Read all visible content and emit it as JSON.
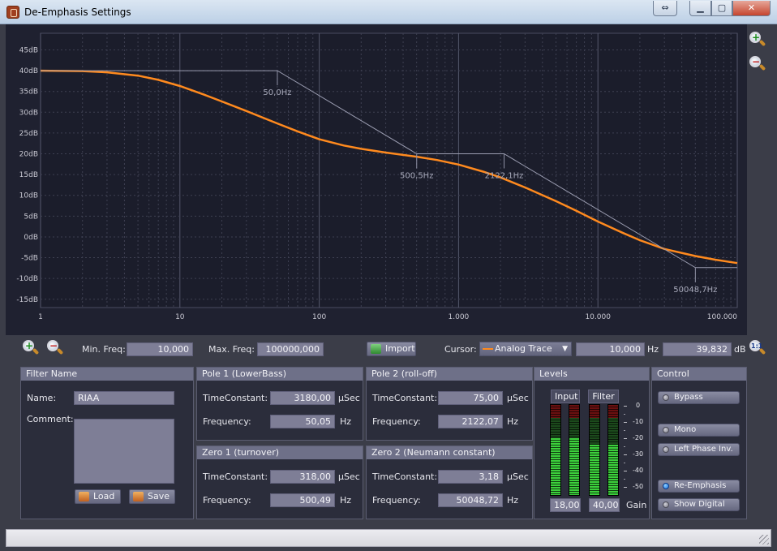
{
  "window": {
    "title": "De-Emphasis Settings"
  },
  "chart_data": {
    "type": "line",
    "x_scale": "log",
    "xlim": [
      1,
      100000
    ],
    "ylim": [
      -17,
      49
    ],
    "x_tick_labels": [
      {
        "x": 1,
        "label": "1"
      },
      {
        "x": 10,
        "label": "10"
      },
      {
        "x": 100,
        "label": "100"
      },
      {
        "x": 1000,
        "label": "1.000"
      },
      {
        "x": 10000,
        "label": "10.000"
      },
      {
        "x": 100000,
        "label": "100.000"
      }
    ],
    "y_ticks": [
      45,
      40,
      35,
      30,
      25,
      20,
      15,
      10,
      5,
      0,
      -5,
      -10,
      -15
    ],
    "y_tick_labels": [
      "45dB",
      "40dB",
      "35dB",
      "30dB",
      "25dB",
      "20dB",
      "15dB",
      "10dB",
      "5dB",
      "0dB",
      "-5dB",
      "-10dB",
      "-15dB"
    ],
    "grid": true,
    "series": [
      {
        "color": "#ff8a1e",
        "x": [
          1,
          2,
          3,
          5,
          7,
          10,
          15,
          20,
          30,
          50,
          70,
          100,
          150,
          200,
          300,
          500,
          700,
          1000,
          1500,
          2000,
          3000,
          5000,
          7000,
          10000,
          15000,
          20000,
          30000,
          50000,
          70000,
          100000
        ],
        "y": [
          40,
          39.9,
          39.6,
          38.8,
          37.8,
          36.3,
          34.2,
          32.6,
          30.3,
          27.3,
          25.4,
          23.5,
          22.0,
          21.2,
          20.3,
          19.3,
          18.5,
          17.4,
          15.7,
          14.3,
          11.9,
          8.6,
          6.3,
          3.7,
          1.0,
          -0.8,
          -2.9,
          -4.6,
          -5.5,
          -6.3
        ]
      },
      {
        "color": "#9a9cb0",
        "x": [
          1,
          50.05,
          500.49,
          2122.07,
          50048.72,
          100000
        ],
        "y": [
          40,
          40,
          20,
          20,
          -7.4,
          -7.4
        ]
      }
    ],
    "annotations": [
      {
        "x": 50.05,
        "y": 40,
        "label": "50,0Hz"
      },
      {
        "x": 500.49,
        "y": 20,
        "label": "500,5Hz"
      },
      {
        "x": 2122.07,
        "y": 20,
        "label": "2122,1Hz"
      },
      {
        "x": 50048.72,
        "y": -7.4,
        "label": "50048,7Hz"
      }
    ]
  },
  "toolbar": {
    "min_freq_label": "Min. Freq:",
    "min_freq": "10,000",
    "max_freq_label": "Max. Freq:",
    "max_freq": "100000,000",
    "import_label": "Import",
    "cursor_label": "Cursor:",
    "cursor_trace": "Analog Trace",
    "cursor_freq": "10,000",
    "hz_unit": "Hz",
    "cursor_db": "39,832",
    "db_unit": "dB"
  },
  "filter": {
    "head": "Filter Name",
    "name_label": "Name:",
    "name": "RIAA",
    "comment_label": "Comment:",
    "load_label": "Load",
    "save_label": "Save"
  },
  "pole1": {
    "head": "Pole 1 (LowerBass)",
    "tc_label": "TimeConstant:",
    "tc": "3180,00",
    "tc_unit": "µSec",
    "freq_label": "Frequency:",
    "freq": "50,05",
    "freq_unit": "Hz"
  },
  "pole2": {
    "head": "Pole 2 (roll-off)",
    "tc_label": "TimeConstant:",
    "tc": "75,00",
    "tc_unit": "µSec",
    "freq_label": "Frequency:",
    "freq": "2122,07",
    "freq_unit": "Hz"
  },
  "zero1": {
    "head": "Zero 1 (turnover)",
    "tc_label": "TimeConstant:",
    "tc": "318,00",
    "tc_unit": "µSec",
    "freq_label": "Frequency:",
    "freq": "500,49",
    "freq_unit": "Hz"
  },
  "zero2": {
    "head": "Zero 2 (Neumann constant)",
    "tc_label": "TimeConstant:",
    "tc": "3,18",
    "tc_unit": "µSec",
    "freq_label": "Frequency:",
    "freq": "50048,72",
    "freq_unit": "Hz"
  },
  "levels": {
    "head": "Levels",
    "input_label": "Input",
    "filter_label": "Filter",
    "scale": [
      "0",
      "-10",
      "-20",
      "-30",
      "-40",
      "-50"
    ],
    "input_value": "18,00",
    "filter_value": "40,00",
    "gain_label": "Gain"
  },
  "control": {
    "head": "Control",
    "bypass": "Bypass",
    "mono": "Mono",
    "left_phase": "Left Phase Inv.",
    "re_emphasis": "Re-Emphasis",
    "show_digital": "Show Digital"
  }
}
